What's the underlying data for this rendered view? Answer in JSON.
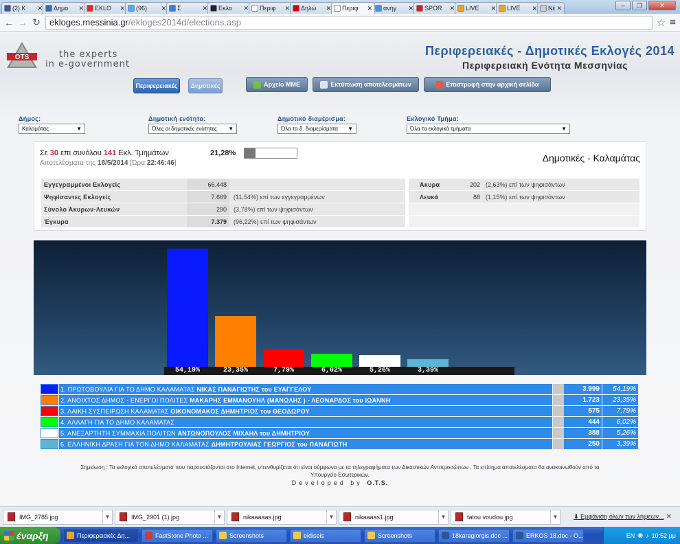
{
  "browser": {
    "tabs": [
      {
        "label": "(2) K",
        "color": "#3b5998",
        "active": false
      },
      {
        "label": "Δημο",
        "color": "#2f6dbd",
        "active": false
      },
      {
        "label": "EKLO",
        "color": "#d93025",
        "active": false
      },
      {
        "label": "(96)",
        "color": "#55acee",
        "active": false
      },
      {
        "label": "Σ",
        "color": "#3a7bd5",
        "active": false
      },
      {
        "label": "Εκλο",
        "color": "#222222",
        "active": false
      },
      {
        "label": "Περιφ",
        "color": "#ffffff",
        "active": false
      },
      {
        "label": "Δηλώ",
        "color": "#cc0000",
        "active": false
      },
      {
        "label": "Περιφ",
        "color": "#ffffff",
        "active": true
      },
      {
        "label": "ανήγ",
        "color": "#4a90e2",
        "active": false
      },
      {
        "label": "SPOR",
        "color": "#d81e1e",
        "active": false
      },
      {
        "label": "LIVE",
        "color": "#f0a030",
        "active": false
      },
      {
        "label": "LIVE",
        "color": "#f0a030",
        "active": false
      },
      {
        "label": "Νέα καρ",
        "color": "#cccccc",
        "active": false
      }
    ],
    "url_host": "ekloges.messinia.gr",
    "url_path": "/ekloges2014d/elections.asp"
  },
  "header": {
    "tagline_1": "the experts",
    "tagline_2": "in e-government",
    "title": "Περιφερειακές - Δημοτικές Εκλογές 2014",
    "subtitle": "Περιφερειακή Ενότητα Μεσσηνίας",
    "logo_text": "OTS"
  },
  "nav": {
    "regional": "Περιφερειακές",
    "municipal": "Δημοτικές",
    "media_file": "Αρχείο ΜΜΕ",
    "print": "Εκτύπωση αποτελεσμάτων",
    "home": "Επιστροφή στην αρχική σελίδα"
  },
  "filters": {
    "dimos_label": "Δήμος:",
    "dimos_value": "Καλαμάτας",
    "enotita_label": "Δημοτική ενότητα:",
    "enotita_value": "Όλες οι δημοτικές ενότητες",
    "diamerisma_label": "Δημοτικό διαμέρισμα:",
    "diamerisma_value": "Όλα τα δ. διαμερίσματα",
    "tmima_label": "Εκλογικό Τμήμα:",
    "tmima_value": "Όλα τα εκλογικά τμήματα"
  },
  "progress": {
    "prefix": "Σε",
    "counted": "30",
    "mid": "επι συνόλου",
    "total": "141",
    "suffix": "Εκλ. Τμημάτων",
    "percent_text": "21,28%",
    "fraction": 0.2128,
    "date_prefix": "Αποτελέσματα της",
    "date": "18/5/2014",
    "time_prefix": "[Ώρα",
    "time": "22:46:46",
    "time_suffix": "]",
    "heading": "Δημοτικές - Καλαμάτας"
  },
  "stats": {
    "registered_label": "Εγγεγραμμένοι Εκλογείς",
    "registered_value": "66.448",
    "voted_label": "Ψηφίσαντες Εκλογείς",
    "voted_value": "7.669",
    "voted_note": "(11,54%) επί των εγγεγραμμένων",
    "invalid_blank_label": "Σύνολο Άκυρων-Λευκών",
    "invalid_blank_value": "290",
    "invalid_blank_note": "(3,78%) επί των ψηφισάντων",
    "valid_label": "Έγκυρα",
    "valid_value": "7.379",
    "valid_note": "(96,22%) επί των ψηφισάντων",
    "invalid_label": "Άκυρα",
    "invalid_value": "202",
    "invalid_note": "(2,63%) επί των ψηφισάντων",
    "blank_label": "Λευκά",
    "blank_value": "88",
    "blank_note": "(1,15%) επί των ψηφισάντων"
  },
  "chart_data": {
    "type": "bar",
    "categories": [
      "1",
      "2",
      "3",
      "4",
      "5",
      "6"
    ],
    "values": [
      54.19,
      23.35,
      7.79,
      6.02,
      5.26,
      3.39
    ],
    "labels": [
      "54,19%",
      "23,35%",
      "7,79%",
      "6,02%",
      "5,26%",
      "3,39%"
    ],
    "colors": [
      "#0a1aff",
      "#ff7f00",
      "#ff0000",
      "#00ff00",
      "#ffffff",
      "#5bb6d6"
    ],
    "ylim": [
      0,
      54.19
    ],
    "title": "",
    "xlabel": "",
    "ylabel": ""
  },
  "candidates": [
    {
      "party": "1. ΠΡΩΤΟΒΟΥΛΙΑ ΓΙΑ ΤΟ ΔΗΜΟ ΚΑΛΑΜΑΤΑΣ",
      "leader": "ΝΙΚΑΣ ΠΑΝΑΓΙΩΤΗΣ του ΕΥΑΓΓΕΛΟΥ",
      "votes": "3.999",
      "pct": "54,19%",
      "color": "#0a1aff"
    },
    {
      "party": "2. ΑΝΟΙΧΤΟΣ ΔΗΜΟΣ - ΕΝΕΡΓΟΙ ΠΟΛΙΤΕΣ",
      "leader": "ΜΑΚΑΡΗΣ ΕΜΜΑΝΟΥΗΛ (ΜΑΝΩΛΗΣ ) - ΛΕΟΝΑΡΔΟΣ του ΙΩΑΝΝΗ",
      "votes": "1.723",
      "pct": "23,35%",
      "color": "#ff7f00"
    },
    {
      "party": "3. ΛΑΙΚΗ ΣΥΣΠΕΙΡΩΣΗ ΚΑΛΑΜΑΤΑΣ",
      "leader": "ΟΙΚΟΝΟΜΑΚΟΣ ΔΗΜΗΤΡΙΟΣ του ΘΕΟΔΩΡΟΥ",
      "votes": "575",
      "pct": "7,79%",
      "color": "#ff0000"
    },
    {
      "party": "4. ΑΛΛΑΓΗ ΓΙΑ ΤΟ ΔΗΜΟ ΚΑΛΑΜΑΤΑΣ",
      "leader": "",
      "votes": "444",
      "pct": "6,02%",
      "color": "#00ff00"
    },
    {
      "party": "5. ΑΝΕΞΑΡΤΗΤΗ ΣΥΜΜΑΧΙΑ ΠΟΛΙΤΩΝ",
      "leader": "ΑΝΤΩΝΟΠΟΥΛΟΣ ΜΙΧΑΗΛ του ΔΗΜΗΤΡΙΟΥ",
      "votes": "388",
      "pct": "5,26%",
      "color": "#ffffff"
    },
    {
      "party": "6. ΕΛΛΗΝΙΚΗ ΔΡΑΣΗ ΓΙΑ ΤΟΝ ΔΗΜΟ ΚΑΛΑΜΑΤΑΣ",
      "leader": "ΔΗΜΗΤΡΟΥΛΙΑΣ ΓΕΩΡΓΙΟΣ του ΠΑΝΑΓΙΩΤΗ",
      "votes": "250",
      "pct": "3,39%",
      "color": "#5bb6d6"
    }
  ],
  "footer": {
    "note_1": "Σημείωση : Τα εκλογικά αποτελέσματα που παρουσιάζονται στο Internet, υπενθυμίζεται ότι είναι σύμφωνα με τα τηλεγραφήματα των Δικαστικών Αντιπροσώπων . Τα επίσημα αποτελέσματα θα ανακοινωθούν από το",
    "note_2": "Υπουργείο Εσωτερικών.",
    "developed": "Developed by",
    "developer": "O.T.S."
  },
  "downloads": {
    "files": [
      "IMG_2785.jpg",
      "IMG_2901 (1).jpg",
      "nikaaaaas.jpg",
      "nikaaaas1.jpg",
      "tatou voudou.jpg"
    ],
    "show_all": "Εμφάνιση όλων των λήψεων..."
  },
  "taskbar": {
    "start": "έναρξη",
    "items": [
      {
        "label": "Περιφερειακές Δη...",
        "color": "#e8a23a",
        "active": true
      },
      {
        "label": "FastStone Photo ...",
        "color": "#d23a3a",
        "active": false
      },
      {
        "label": "Screenshots",
        "color": "#f2c94c",
        "active": false
      },
      {
        "label": "eidiseis",
        "color": "#f2c94c",
        "active": false
      },
      {
        "label": "Screenshots",
        "color": "#f2c94c",
        "active": false
      },
      {
        "label": "18karagiorgis.doc ...",
        "color": "#2b5797",
        "active": false
      },
      {
        "label": "ERKOS 18.doc - O...",
        "color": "#2b5797",
        "active": false
      }
    ],
    "lang": "EN",
    "clock": "10:52 μμ"
  }
}
